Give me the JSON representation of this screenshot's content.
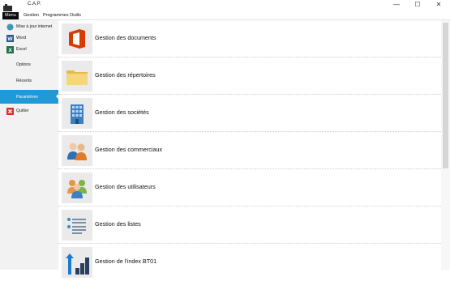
{
  "window": {
    "title": "C.A.P.",
    "minimize": "—",
    "maximize": "☐",
    "close": "✕"
  },
  "menubar": {
    "items": [
      "Menu",
      "Gestion",
      "Programmes",
      "Outils"
    ]
  },
  "sidebar": {
    "items": [
      {
        "label": "Mise à jour internet",
        "icon": "globe-icon"
      },
      {
        "label": "Word",
        "icon": "word-icon"
      },
      {
        "label": "Excel",
        "icon": "excel-icon"
      },
      {
        "label": "Options"
      },
      {
        "label": "Récents"
      },
      {
        "label": "Paramètres",
        "selected": true
      },
      {
        "label": "Quitter",
        "icon": "quit-icon"
      }
    ]
  },
  "main": {
    "rows": [
      {
        "label": "Gestion des documents",
        "icon": "office-icon"
      },
      {
        "label": "Gestion des répertoires",
        "icon": "folder-icon"
      },
      {
        "label": "Gestion des sociétés",
        "icon": "building-icon"
      },
      {
        "label": "Gestion des commerciaux",
        "icon": "salespeople-icon"
      },
      {
        "label": "Gestion des utilisateurs",
        "icon": "users-icon"
      },
      {
        "label": "Gestion des listes",
        "icon": "list-icon"
      },
      {
        "label": "Gestion de l'index BT01",
        "icon": "index-chart-icon"
      }
    ]
  },
  "colors": {
    "accent": "#1f9ad6",
    "menu_active": "#0b0b0b",
    "office": "#d83b01"
  }
}
